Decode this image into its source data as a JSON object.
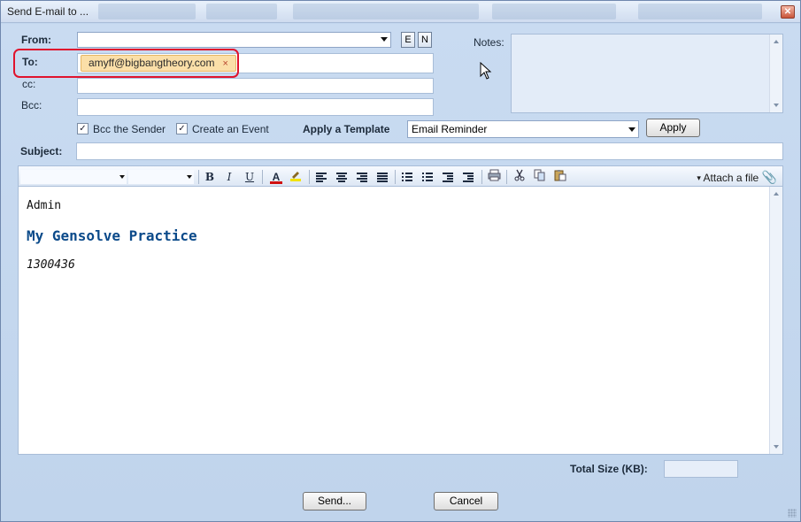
{
  "window": {
    "title": "Send E-mail to ..."
  },
  "form": {
    "from_label": "From:",
    "to_label": "To:",
    "cc_label": "cc:",
    "bcc_label": "Bcc:",
    "subject_label": "Subject:",
    "notes_label": "Notes:",
    "btn_e": "E",
    "btn_n": "N",
    "recipient": "amyff@bigbangtheory.com",
    "recipient_remove": "×",
    "bcc_sender_label": "Bcc the Sender",
    "create_event_label": "Create an Event",
    "check_mark": "✓",
    "template_label": "Apply a Template",
    "template_value": "Email Reminder",
    "apply_label": "Apply"
  },
  "toolbar": {
    "bold": "B",
    "italic": "I",
    "underline": "U",
    "font_color": "A",
    "attach_label": "Attach a file"
  },
  "editor": {
    "line1": "Admin",
    "line2": "My Gensolve Practice",
    "line3": "1300436",
    "line2_color": "#0b4a8a"
  },
  "footer": {
    "total_size_label": "Total Size (KB):",
    "send_label": "Send...",
    "cancel_label": "Cancel"
  },
  "colors": {
    "highlight_box": "#e0132d",
    "chip_bg": "#fbdfa8",
    "window_bg": "#c2d6ee"
  }
}
